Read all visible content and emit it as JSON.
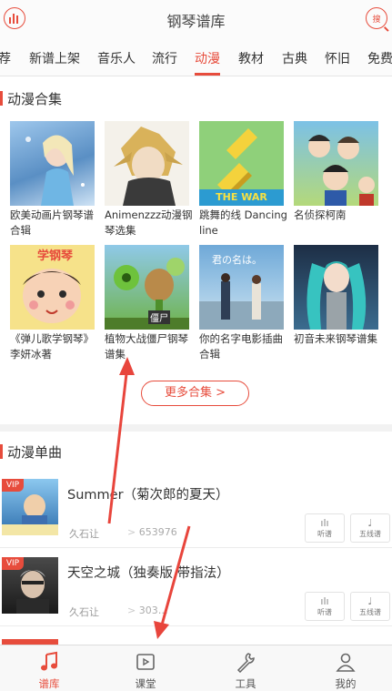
{
  "header": {
    "title": "钢琴谱库",
    "left_icon": "equalizer-icon",
    "right_icon": "search-icon",
    "right_icon_text": "搜"
  },
  "tabs": [
    {
      "label": "荐"
    },
    {
      "label": "新谱上架"
    },
    {
      "label": "音乐人"
    },
    {
      "label": "流行"
    },
    {
      "label": "动漫"
    },
    {
      "label": "教材"
    },
    {
      "label": "古典"
    },
    {
      "label": "怀旧"
    },
    {
      "label": "免费"
    }
  ],
  "active_tab": "动漫",
  "collections": {
    "title": "动漫合集",
    "items": [
      {
        "caption": "欧美动画片钢琴谱合辑"
      },
      {
        "caption": "Animenzzz动漫钢琴选集"
      },
      {
        "caption": "跳舞的线 Dancing line"
      },
      {
        "caption": "名侦探柯南"
      },
      {
        "caption": "《弹儿歌学钢琴》李妍冰著"
      },
      {
        "caption": "植物大战僵尸钢琴谱集"
      },
      {
        "caption": "你的名字电影插曲合辑"
      },
      {
        "caption": "初音未来钢琴谱集"
      }
    ],
    "thumb_texts": {
      "the_war": "THE WAR",
      "pvz": "僵尸",
      "yourname": "君の名は。",
      "kids": "学钢琴"
    },
    "more_label": "更多合集 >"
  },
  "singles": {
    "title": "动漫单曲",
    "vip_label": "VIP",
    "listen_label": "听谱",
    "staff_label": "五线谱",
    "items": [
      {
        "name": "Summer（菊次郎的夏天）",
        "artist": "久石让",
        "plays": "653976"
      },
      {
        "name": "天空之城（独奏版 带指法）",
        "artist": "久石让",
        "plays": "303…"
      }
    ]
  },
  "bottom_nav": [
    {
      "label": "谱库",
      "icon": "music-note-icon"
    },
    {
      "label": "课堂",
      "icon": "play-video-icon"
    },
    {
      "label": "工具",
      "icon": "wrench-icon"
    },
    {
      "label": "我的",
      "icon": "person-icon"
    }
  ],
  "colors": {
    "accent": "#e74c3c",
    "text": "#333333",
    "muted": "#999999",
    "annotation_arrow": "#e8453c"
  }
}
